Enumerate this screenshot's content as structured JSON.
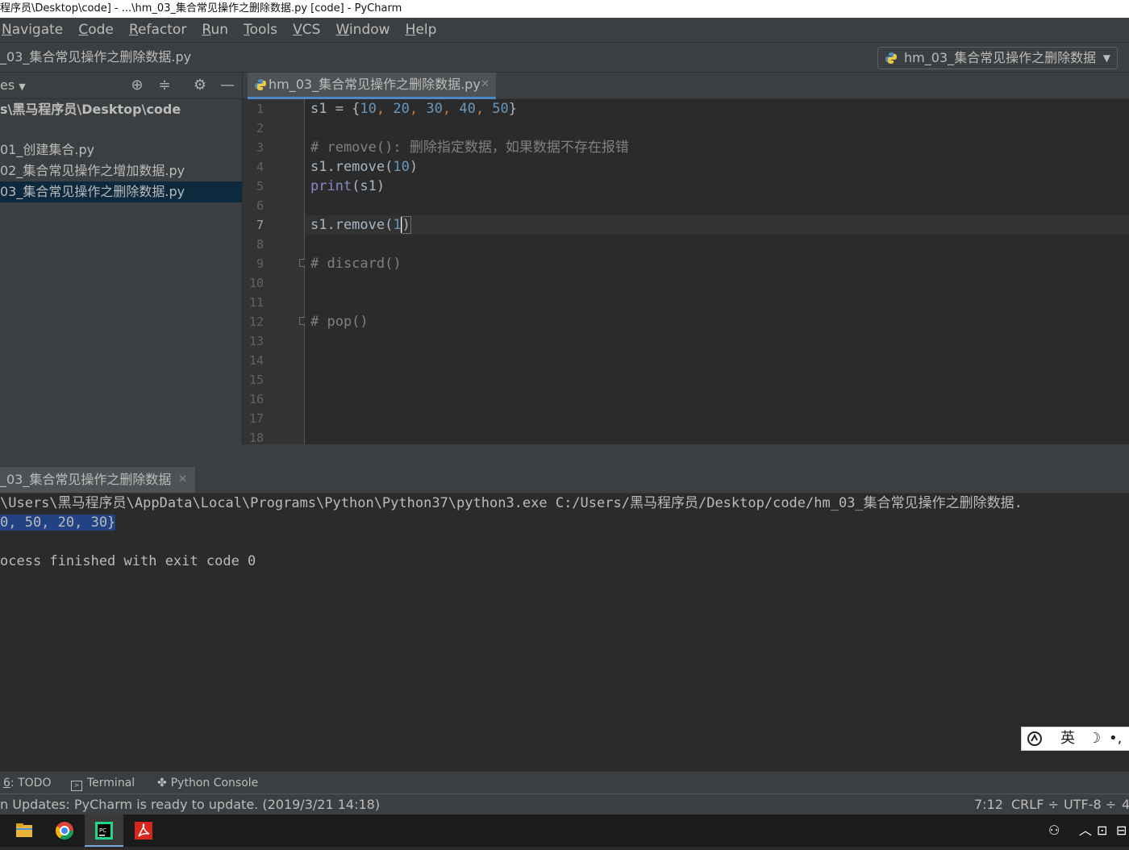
{
  "window": {
    "title": "程序员\\Desktop\\code] - ...\\hm_03_集合常见操作之删除数据.py [code] - PyCharm"
  },
  "menu": [
    {
      "label": "Navigate",
      "u": "N",
      "rest": "avigate"
    },
    {
      "label": "Code",
      "u": "C",
      "rest": "ode"
    },
    {
      "label": "Refactor",
      "u": "R",
      "rest": "efactor"
    },
    {
      "label": "Run",
      "u": "R",
      "rest": "un"
    },
    {
      "label": "Tools",
      "u": "T",
      "rest": "ools"
    },
    {
      "label": "VCS",
      "u": "V",
      "rest": "CS"
    },
    {
      "label": "Window",
      "u": "W",
      "rest": "indow"
    },
    {
      "label": "Help",
      "u": "H",
      "rest": "elp"
    }
  ],
  "nav": {
    "breadcrumb": "_03_集合常见操作之删除数据.py",
    "run_config": "hm_03_集合常见操作之删除数据"
  },
  "project": {
    "header": "es",
    "root": "s\\黑马程序员\\Desktop\\code",
    "files": [
      "01_创建集合.py",
      "02_集合常见操作之增加数据.py",
      "03_集合常见操作之删除数据.py"
    ],
    "selected_index": 2
  },
  "editor": {
    "tab_label": "hm_03_集合常见操作之删除数据.py",
    "line_numbers": [
      "1",
      "2",
      "3",
      "4",
      "5",
      "6",
      "7",
      "8",
      "9",
      "10",
      "11",
      "12",
      "13",
      "14",
      "15",
      "16",
      "17",
      "18"
    ],
    "current_line": 7,
    "code": {
      "l1_var": "s1 = {",
      "l1_n1": "10",
      "l1_n2": "20",
      "l1_n3": "30",
      "l1_n4": "40",
      "l1_n5": "50",
      "l3": "# remove(): 删除指定数据，如果数据不存在报错",
      "l4_a": "s1.remove(",
      "l4_n": "10",
      "l4_b": ")",
      "l5_fn": "print",
      "l5_rest": "(s1)",
      "l7_a": "s1.remove(",
      "l7_n": "1",
      "l7_b": ")",
      "l9": "# discard()",
      "l12": "# pop()"
    }
  },
  "run": {
    "tab_label": "_03_集合常见操作之删除数据",
    "lines": {
      "cmd": "\\Users\\黑马程序员\\AppData\\Local\\Programs\\Python\\Python37\\python3.exe C:/Users/黑马程序员/Desktop/code/hm_03_集合常见操作之删除数据.",
      "output": "0, 50, 20, 30}",
      "finished": "ocess finished with exit code 0"
    }
  },
  "ime": {
    "lang": "英"
  },
  "toolstrip": {
    "todo_num": "6",
    "todo_label": ": TODO",
    "terminal": "Terminal",
    "python_console": "Python Console"
  },
  "status": {
    "message": "n Updates: PyCharm is ready to update. (2019/3/21 14:18)",
    "position": "7:12",
    "line_sep": "CRLF ÷",
    "encoding": "UTF-8 ÷",
    "indent": "4"
  },
  "colors": {
    "accent": "#4a88c7",
    "selection": "#0d293e",
    "console_selection": "#214283"
  }
}
